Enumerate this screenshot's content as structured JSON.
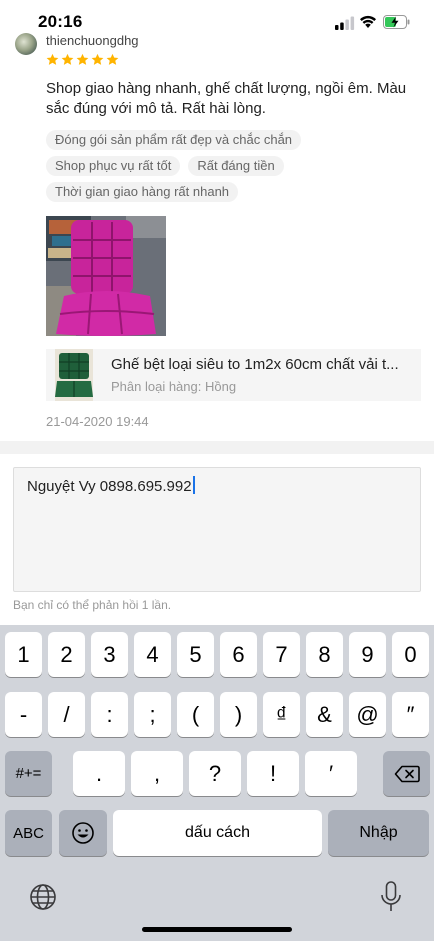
{
  "status_bar": {
    "time": "20:16"
  },
  "review": {
    "username": "thienchuongdhg",
    "rating": 5,
    "text": "Shop giao hàng nhanh, ghế chất lượng, ngồi êm. Màu sắc đúng với mô tả. Rất hài lòng.",
    "tags": [
      "Đóng gói sản phẩm rất đẹp và chắc chắn",
      "Shop phục vụ rất tốt",
      "Rất đáng tiền",
      "Thời gian giao hàng rất nhanh"
    ],
    "product": {
      "name": "Ghế bệt loại siêu to 1m2x 60cm chất vải t...",
      "variant": "Phân loại hàng: Hồng"
    },
    "date": "21-04-2020 19:44"
  },
  "reply": {
    "value": "Nguyệt Vy 0898.695.992",
    "hint": "Bạn chỉ có thể phản hồi 1 lần."
  },
  "keyboard": {
    "row1": [
      "1",
      "2",
      "3",
      "4",
      "5",
      "6",
      "7",
      "8",
      "9",
      "0"
    ],
    "row2": [
      "-",
      "/",
      ":",
      ";",
      "(",
      ")",
      "₫",
      "&",
      "@",
      "″"
    ],
    "row3_mode": "#+=",
    "row3": [
      ".",
      ",",
      "?",
      "!",
      "′"
    ],
    "abc": "ABC",
    "space": "dấu cách",
    "enter": "Nhập",
    "icons": [
      "delete-icon",
      "emoji-icon",
      "globe-icon",
      "microphone-icon"
    ]
  },
  "colors": {
    "star": "#ffb400",
    "caret": "#1a73e8",
    "keyboard_bg": "#d1d4da",
    "dark_key": "#abb0ba"
  }
}
